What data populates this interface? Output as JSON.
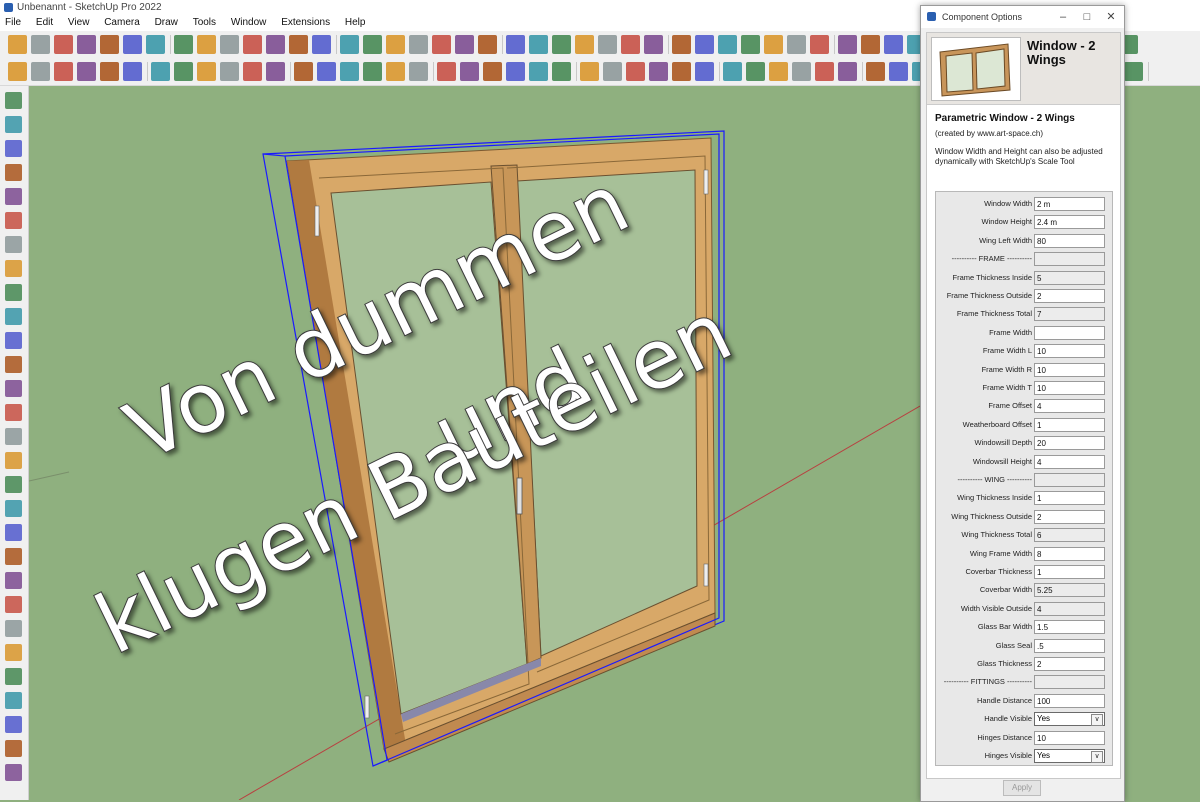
{
  "app": {
    "window_title": "Unbenannt - SketchUp Pro 2022",
    "menu": [
      "File",
      "Edit",
      "View",
      "Camera",
      "Draw",
      "Tools",
      "Window",
      "Extensions",
      "Help"
    ]
  },
  "overlay_text": {
    "line1": "Von dummen",
    "line2": "und",
    "line3": "klugen Bauteilen"
  },
  "dialog": {
    "title": "Component Options",
    "component_name": "Window - 2 Wings",
    "heading": "Parametric Window - 2 Wings",
    "created_by": "(created by www.art-space.ch)",
    "note": "Window Width and Height can also be adjusted dynamically with SketchUp's Scale Tool",
    "apply_label": "Apply",
    "fields": [
      {
        "label": "Window Width",
        "value": "2 m",
        "kind": "input"
      },
      {
        "label": "Window Height",
        "value": "2.4 m",
        "kind": "input"
      },
      {
        "label": "Wing Left Width",
        "value": "80",
        "kind": "input"
      },
      {
        "label": "---------- FRAME ----------",
        "value": "",
        "kind": "readonly"
      },
      {
        "label": "Frame Thickness Inside",
        "value": "5",
        "kind": "readonly"
      },
      {
        "label": "Frame Thickness Outside",
        "value": "2",
        "kind": "input"
      },
      {
        "label": "Frame Thickness Total",
        "value": "7",
        "kind": "readonly"
      },
      {
        "label": "Frame Width",
        "value": "",
        "kind": "input"
      },
      {
        "label": "Frame Width L",
        "value": "10",
        "kind": "input"
      },
      {
        "label": "Frame Width R",
        "value": "10",
        "kind": "input"
      },
      {
        "label": "Frame Width T",
        "value": "10",
        "kind": "input"
      },
      {
        "label": "Frame Offset",
        "value": "4",
        "kind": "input"
      },
      {
        "label": "Weatherboard Offset",
        "value": "1",
        "kind": "input"
      },
      {
        "label": "Windowsill Depth",
        "value": "20",
        "kind": "input"
      },
      {
        "label": "Windowsill Height",
        "value": "4",
        "kind": "input"
      },
      {
        "label": "---------- WING ----------",
        "value": "",
        "kind": "readonly"
      },
      {
        "label": "Wing Thickness Inside",
        "value": "1",
        "kind": "input"
      },
      {
        "label": "Wing Thickness Outside",
        "value": "2",
        "kind": "input"
      },
      {
        "label": "Wing Thickness Total",
        "value": "6",
        "kind": "readonly"
      },
      {
        "label": "Wing Frame Width",
        "value": "8",
        "kind": "input"
      },
      {
        "label": "Coverbar Thickness",
        "value": "1",
        "kind": "input"
      },
      {
        "label": "Coverbar Width",
        "value": "5.25",
        "kind": "readonly"
      },
      {
        "label": "Width Visible Outside",
        "value": "4",
        "kind": "readonly"
      },
      {
        "label": "Glass Bar Width",
        "value": "1.5",
        "kind": "input"
      },
      {
        "label": "Glass Seal",
        "value": ".5",
        "kind": "input"
      },
      {
        "label": "Glass Thickness",
        "value": "2",
        "kind": "input"
      },
      {
        "label": "---------- FITTINGS ----------",
        "value": "",
        "kind": "readonly"
      },
      {
        "label": "Handle Distance",
        "value": "100",
        "kind": "input"
      },
      {
        "label": "Handle Visible",
        "value": "Yes",
        "kind": "select"
      },
      {
        "label": "Hinges Distance",
        "value": "10",
        "kind": "input"
      },
      {
        "label": "Hinges Visible",
        "value": "Yes",
        "kind": "select"
      }
    ]
  },
  "colors": {
    "background": "#8fb07f",
    "wood": "#d8a868",
    "wood_dark": "#b07a40",
    "selection": "#1a1aff",
    "axis_red": "#b84040",
    "overlay_fill": "#ffffff",
    "overlay_shadow": "#3a3a3a"
  },
  "icons": {
    "app": "sketchup-icon",
    "toolbars": [
      "select-icon",
      "eraser-icon",
      "paint-icon",
      "line-icon",
      "arc-icon",
      "rectangle-icon",
      "circle-icon",
      "polygon-icon",
      "push-pull-icon",
      "move-icon",
      "rotate-icon",
      "scale-icon",
      "offset-icon",
      "tape-measure-icon",
      "text-icon",
      "axes-icon",
      "orbit-icon",
      "pan-icon",
      "zoom-icon",
      "walk-icon",
      "section-icon"
    ]
  }
}
